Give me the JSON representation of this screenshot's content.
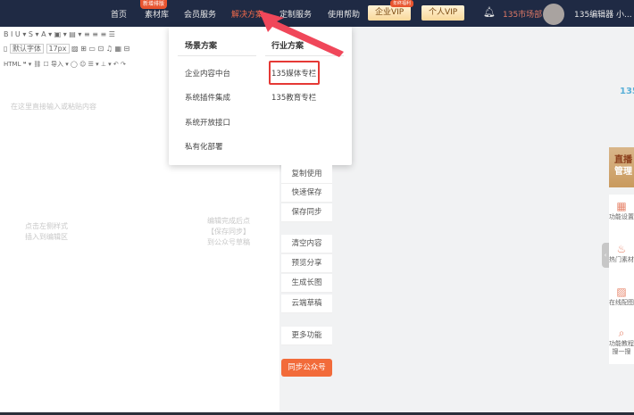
{
  "nav": {
    "items": [
      "首页",
      "素材库",
      "会员服务",
      "解决方案",
      "定制服务",
      "使用帮助"
    ],
    "hot_badge": "新增排版",
    "enterprise_vip": "企业VIP",
    "enterprise_tag": "年终福利",
    "personal_vip": "个人VIP",
    "team": "135市场部",
    "user": "135编辑器 小..."
  },
  "toolbar": {
    "row1": "B  I  U ▾  S ▾  A ▾  ▣ ▾  ▤ ▾  ≡  ≡  ≡  ☰",
    "font": "默认字体",
    "size": "17px",
    "row2": "▨  ⊞  ▭  ⊡  ♫  ▦  ⊟",
    "row3": "HTML  ❝ ▾  ⛓  ☐  导入 ▾  ◯  ☺  ☰ ▾  ⊥ ▾  ↶  ↷"
  },
  "editor": {
    "placeholder": "在这里直接输入或粘贴内容",
    "hint_left": [
      "点击左侧样式",
      "插入到编辑区"
    ],
    "hint_right": [
      "编辑完成后点",
      "【保存同步】",
      "到公众号草稿"
    ]
  },
  "dropdown": {
    "col1_title": "场景方案",
    "col2_title": "行业方案",
    "col1": [
      "企业内容中台",
      "系统插件集成",
      "系统开放接口",
      "私有化部署"
    ],
    "col2": [
      "135媒体专栏",
      "135教育专栏"
    ]
  },
  "side_buttons": {
    "group1": [
      "复制使用",
      "快速保存",
      "保存同步"
    ],
    "group2": [
      "清空内容",
      "预览分享",
      "生成长图",
      "云端草稿"
    ],
    "more": "更多功能",
    "sync": "同步公众号"
  },
  "right_panel": {
    "logo": "135",
    "banner": [
      "直播",
      "管理"
    ],
    "items": [
      {
        "icon": "grid-icon",
        "label": "功能设置"
      },
      {
        "icon": "fire-icon",
        "label": "热门素材"
      },
      {
        "icon": "image-icon",
        "label": "在线配图"
      },
      {
        "icon": "search-icon",
        "label": "功能教程 搜一搜"
      }
    ]
  },
  "colors": {
    "nav_bg": "#1f2a44",
    "accent": "#f06a4a",
    "highlight_box": "#e53935",
    "sync_button": "#f26b3a"
  }
}
